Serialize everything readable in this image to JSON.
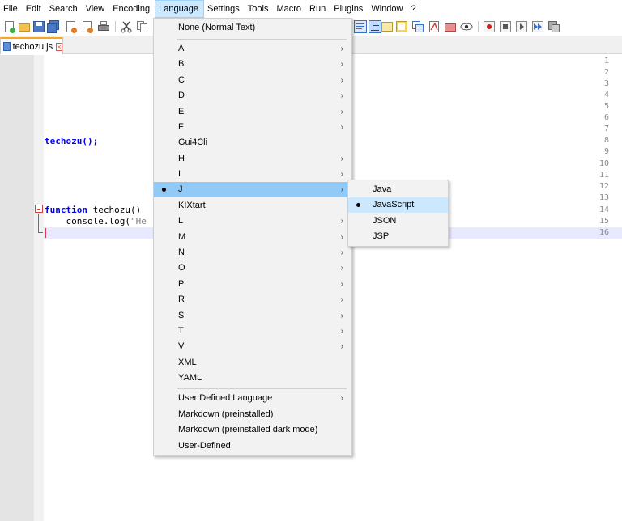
{
  "menubar": [
    "File",
    "Edit",
    "Search",
    "View",
    "Encoding",
    "Language",
    "Settings",
    "Tools",
    "Macro",
    "Run",
    "Plugins",
    "Window",
    "?"
  ],
  "active_menu": "Language",
  "tab": {
    "label": "techozu.js",
    "close": "×"
  },
  "gutter": {
    "line_numbers": [
      "1",
      "2",
      "3",
      "4",
      "5",
      "6",
      "7",
      "8",
      "9",
      "10",
      "11",
      "12",
      "13",
      "14",
      "15",
      "16"
    ]
  },
  "code": {
    "line8": "techozu();",
    "line14_kw": "function",
    "line14_rest": " techozu()",
    "line15_a": "    console.log(",
    "line15_str": "\"He"
  },
  "language_menu": {
    "top": "None (Normal Text)",
    "items": [
      {
        "label": "A",
        "arrow": "›"
      },
      {
        "label": "B",
        "arrow": "›"
      },
      {
        "label": "C",
        "arrow": "›"
      },
      {
        "label": "D",
        "arrow": "›"
      },
      {
        "label": "E",
        "arrow": "›"
      },
      {
        "label": "F",
        "arrow": "›"
      },
      {
        "label": "Gui4Cli",
        "arrow": ""
      },
      {
        "label": "H",
        "arrow": "›"
      },
      {
        "label": "I",
        "arrow": "›"
      },
      {
        "label": "J",
        "arrow": "›"
      },
      {
        "label": "KIXtart",
        "arrow": ""
      },
      {
        "label": "L",
        "arrow": "›"
      },
      {
        "label": "M",
        "arrow": "›"
      },
      {
        "label": "N",
        "arrow": "›"
      },
      {
        "label": "O",
        "arrow": "›"
      },
      {
        "label": "P",
        "arrow": "›"
      },
      {
        "label": "R",
        "arrow": "›"
      },
      {
        "label": "S",
        "arrow": "›"
      },
      {
        "label": "T",
        "arrow": "›"
      },
      {
        "label": "V",
        "arrow": "›"
      },
      {
        "label": "XML",
        "arrow": ""
      },
      {
        "label": "YAML",
        "arrow": ""
      }
    ],
    "bottom": [
      {
        "label": "User Defined Language",
        "arrow": "›"
      },
      {
        "label": "Markdown (preinstalled)",
        "arrow": ""
      },
      {
        "label": "Markdown (preinstalled dark mode)",
        "arrow": ""
      },
      {
        "label": "User-Defined",
        "arrow": ""
      }
    ]
  },
  "j_submenu": {
    "items": [
      "Java",
      "JavaScript",
      "JSON",
      "JSP"
    ],
    "selected": "JavaScript"
  },
  "colors": {
    "menu_highlight": "#91c9f7",
    "keyword": "#0000ff",
    "current_line": "#e8e8ff",
    "fold_marker": "#d04040"
  },
  "toolbar_icons": [
    "new-file-icon",
    "open-folder-icon",
    "save-icon",
    "save-all-icon",
    "close-icon",
    "close-all-icon",
    "print-icon",
    "cut-icon",
    "copy-icon",
    "word-wrap-icon",
    "indent-guide-icon",
    "doc-map-icon",
    "function-list-icon",
    "folder-workspace-icon",
    "monitoring-icon",
    "record-macro-icon",
    "stop-record-icon",
    "playback-icon",
    "run-macro-multiple-icon",
    "save-macro-icon"
  ]
}
